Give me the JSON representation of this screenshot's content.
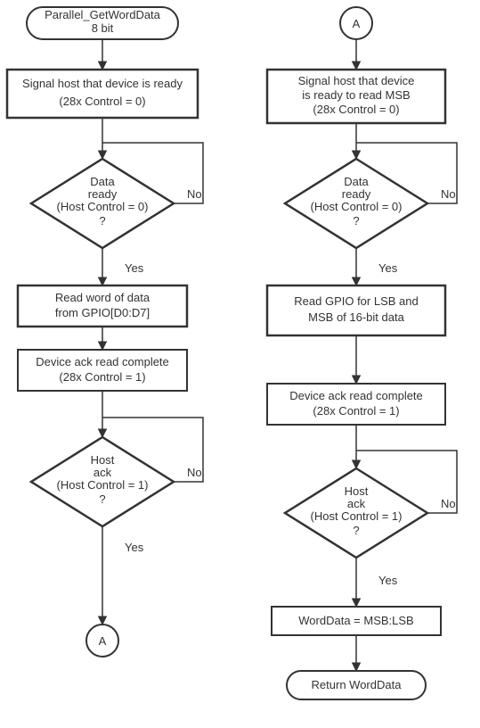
{
  "left": {
    "start": {
      "l1": "Parallel_GetWordData",
      "l2": "8 bit"
    },
    "signal": {
      "l1": "Signal host that device is ready",
      "l2": "(28x Control = 0)"
    },
    "dataReady": {
      "l1": "Data",
      "l2": "ready",
      "l3": "(Host Control = 0)",
      "l4": "?"
    },
    "read": {
      "l1": "Read word of data",
      "l2": "from GPIO[D0:D7]"
    },
    "ack": {
      "l1": "Device ack read complete",
      "l2": "(28x Control = 1)"
    },
    "hostAck": {
      "l1": "Host",
      "l2": "ack",
      "l3": "(Host Control = 1)",
      "l4": "?"
    },
    "yes": "Yes",
    "no": "No",
    "conn": "A"
  },
  "right": {
    "conn": "A",
    "signal": {
      "l1": "Signal host that device",
      "l2": "is ready to read MSB",
      "l3": "(28x Control = 0)"
    },
    "dataReady": {
      "l1": "Data",
      "l2": "ready",
      "l3": "(Host Control = 0)",
      "l4": "?"
    },
    "read": {
      "l1": "Read GPIO for LSB and",
      "l2": "MSB of 16-bit data"
    },
    "ack": {
      "l1": "Device ack read complete",
      "l2": "(28x Control = 1)"
    },
    "hostAck": {
      "l1": "Host",
      "l2": "ack",
      "l3": "(Host Control = 1)",
      "l4": "?"
    },
    "word": {
      "l1": "WordData = MSB:LSB"
    },
    "ret": {
      "l1": "Return WordData"
    },
    "yes": "Yes",
    "no": "No"
  },
  "chart_data": [
    {
      "type": "flowchart",
      "title": "Parallel_GetWordData 8 bit (part 1)",
      "nodes": [
        {
          "id": "start",
          "shape": "terminator",
          "text": "Parallel_GetWordData 8 bit"
        },
        {
          "id": "signal",
          "shape": "process",
          "text": "Signal host that device is ready (28x Control = 0)"
        },
        {
          "id": "dready",
          "shape": "decision",
          "text": "Data ready (Host Control = 0) ?"
        },
        {
          "id": "read",
          "shape": "process",
          "text": "Read word of data from GPIO[D0:D7]"
        },
        {
          "id": "ack",
          "shape": "process",
          "text": "Device ack read complete (28x Control = 1)"
        },
        {
          "id": "hack",
          "shape": "decision",
          "text": "Host ack (Host Control = 1) ?"
        },
        {
          "id": "A",
          "shape": "connector",
          "text": "A"
        }
      ],
      "edges": [
        {
          "from": "start",
          "to": "signal"
        },
        {
          "from": "signal",
          "to": "dready"
        },
        {
          "from": "dready",
          "to": "read",
          "label": "Yes"
        },
        {
          "from": "dready",
          "to": "dready",
          "label": "No"
        },
        {
          "from": "read",
          "to": "ack"
        },
        {
          "from": "ack",
          "to": "hack"
        },
        {
          "from": "hack",
          "to": "A",
          "label": "Yes"
        },
        {
          "from": "hack",
          "to": "hack",
          "label": "No"
        }
      ]
    },
    {
      "type": "flowchart",
      "title": "Parallel_GetWordData 8 bit (part 2)",
      "nodes": [
        {
          "id": "A",
          "shape": "connector",
          "text": "A"
        },
        {
          "id": "signal",
          "shape": "process",
          "text": "Signal host that device is ready to read MSB (28x Control = 0)"
        },
        {
          "id": "dready",
          "shape": "decision",
          "text": "Data ready (Host Control = 0) ?"
        },
        {
          "id": "read",
          "shape": "process",
          "text": "Read GPIO for LSB and MSB of 16-bit data"
        },
        {
          "id": "ack",
          "shape": "process",
          "text": "Device ack read complete (28x Control = 1)"
        },
        {
          "id": "hack",
          "shape": "decision",
          "text": "Host ack (Host Control = 1) ?"
        },
        {
          "id": "word",
          "shape": "process",
          "text": "WordData = MSB:LSB"
        },
        {
          "id": "ret",
          "shape": "terminator",
          "text": "Return WordData"
        }
      ],
      "edges": [
        {
          "from": "A",
          "to": "signal"
        },
        {
          "from": "signal",
          "to": "dready"
        },
        {
          "from": "dready",
          "to": "read",
          "label": "Yes"
        },
        {
          "from": "dready",
          "to": "dready",
          "label": "No"
        },
        {
          "from": "read",
          "to": "ack"
        },
        {
          "from": "ack",
          "to": "hack"
        },
        {
          "from": "hack",
          "to": "word",
          "label": "Yes"
        },
        {
          "from": "hack",
          "to": "hack",
          "label": "No"
        },
        {
          "from": "word",
          "to": "ret"
        }
      ]
    }
  ]
}
